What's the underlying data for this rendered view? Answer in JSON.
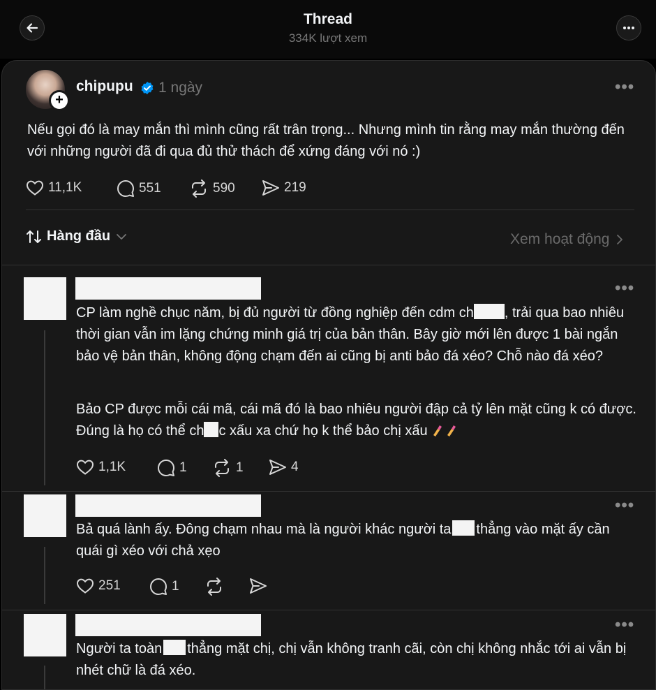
{
  "header": {
    "title": "Thread",
    "views": "334K lượt xem"
  },
  "post": {
    "username": "chipupu",
    "time": "1 ngày",
    "text": "Nếu gọi đó là may mắn thì mình cũng rất trân trọng... Nhưng mình tin rằng may mắn thường đến với những người đã đi qua đủ thử thách để xứng đáng với nó :)",
    "likes": "11,1K",
    "replies": "551",
    "reposts": "590",
    "shares": "219"
  },
  "sort": {
    "label": "Hàng đầu",
    "activity_link": "Xem hoạt động"
  },
  "comments": [
    {
      "p1_a": "CP làm nghề chục năm, bị đủ người từ đồng nghiệp đến cdm ch",
      "p1_b": ", trải qua bao nhiêu thời gian vẫn im lặng chứng minh giá trị của bản thân. Bây giờ mới lên được 1 bài ngắn bảo vệ bản thân, không động chạm đến ai cũng bị anti bảo đá xéo? Chỗ nào đá xéo?",
      "p2_a": "Bảo CP được mỗi cái mã, cái mã đó là bao nhiêu người đập cả tỷ lên mặt cũng k có được. Đúng là họ có thể ch",
      "p2_b": "c xấu xa chứ họ k thể bảo chị xấu",
      "likes": "1,1K",
      "replies": "1",
      "reposts": "1",
      "shares": "4"
    },
    {
      "p1_a": "Bả quá lành ấy. Đông chạm nhau mà là người khác người ta",
      "p1_b": "thẳng vào mặt ấy cần quái gì xéo với chả xẹo",
      "likes": "251",
      "replies": "1"
    },
    {
      "p1_a": "Người ta toàn",
      "p1_b": "thẳng mặt chị, chị vẫn không tranh cãi, còn chị không nhắc tới ai vẫn bị nhét chữ là đá xéo."
    }
  ],
  "icons": [
    "back-arrow-icon",
    "more-icon",
    "verified-icon",
    "heart-icon",
    "comment-icon",
    "repost-icon",
    "share-icon",
    "sort-icon",
    "chevron-down-icon",
    "chevron-right-icon",
    "nail-polish-icon"
  ],
  "colors": {
    "background": "#000000",
    "panel": "#181818",
    "verified": "#0095f6",
    "muted": "#777777"
  }
}
